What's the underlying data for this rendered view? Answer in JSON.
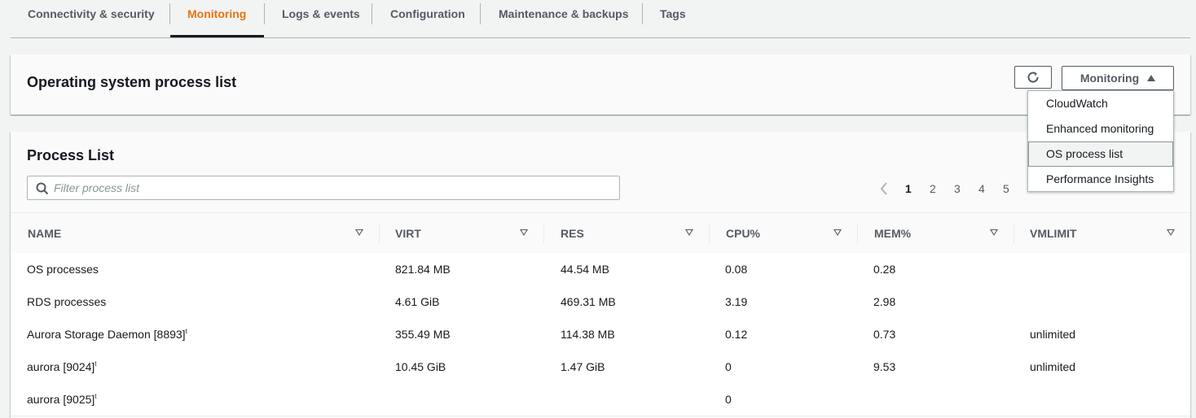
{
  "tabs": [
    {
      "label": "Connectivity & security",
      "active": false
    },
    {
      "label": "Monitoring",
      "active": true
    },
    {
      "label": "Logs & events",
      "active": false
    },
    {
      "label": "Configuration",
      "active": false
    },
    {
      "label": "Maintenance & backups",
      "active": false
    },
    {
      "label": "Tags",
      "active": false
    }
  ],
  "header_panel": {
    "title": "Operating system process list",
    "refresh_icon": "refresh-icon",
    "monitoring_button": "Monitoring"
  },
  "monitoring_menu": {
    "items": [
      "CloudWatch",
      "Enhanced monitoring",
      "OS process list",
      "Performance Insights"
    ],
    "selected": "OS process list"
  },
  "process_list": {
    "title": "Process List",
    "filter_placeholder": "Filter process list",
    "pagination": {
      "pages": [
        "1",
        "2",
        "3",
        "4",
        "5"
      ],
      "current": "1"
    },
    "columns": [
      "NAME",
      "VIRT",
      "RES",
      "CPU%",
      "MEM%",
      "VMLIMIT"
    ],
    "rows": [
      {
        "name": "OS processes",
        "marker": "",
        "virt": "821.84 MB",
        "res": "44.54 MB",
        "cpu": "0.08",
        "mem": "0.28",
        "vmlimit": ""
      },
      {
        "name": "RDS processes",
        "marker": "",
        "virt": "4.61 GiB",
        "res": "469.31 MB",
        "cpu": "3.19",
        "mem": "2.98",
        "vmlimit": ""
      },
      {
        "name": "Aurora Storage Daemon [8893]",
        "marker": "t",
        "virt": "355.49 MB",
        "res": "114.38 MB",
        "cpu": "0.12",
        "mem": "0.73",
        "vmlimit": "unlimited"
      },
      {
        "name": "aurora [9024]",
        "marker": "t",
        "virt": "10.45 GiB",
        "res": "1.47 GiB",
        "cpu": "0",
        "mem": "9.53",
        "vmlimit": "unlimited"
      },
      {
        "name": "aurora [9025]",
        "marker": "t",
        "virt": "",
        "res": "",
        "cpu": "0",
        "mem": "",
        "vmlimit": ""
      }
    ]
  },
  "colors": {
    "accent": "#ec7211",
    "text": "#16191f",
    "muted": "#545b64",
    "border": "#aab7b8",
    "background": "#f2f3f3"
  }
}
